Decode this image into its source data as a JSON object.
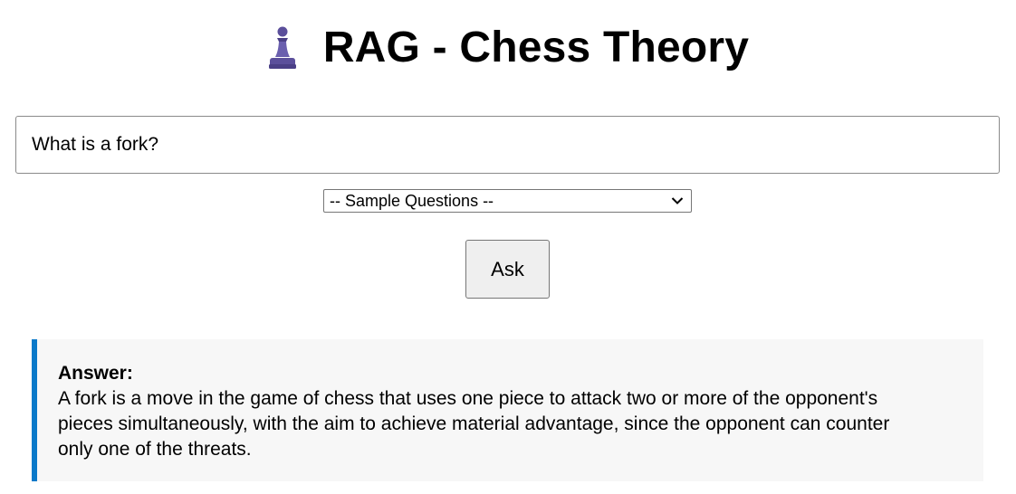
{
  "header": {
    "title": "RAG - Chess Theory",
    "icon": "chess-pawn-icon",
    "icon_color": "#5b4f9b"
  },
  "query": {
    "value": "What is a fork?"
  },
  "sample_questions": {
    "selected": "-- Sample Questions --"
  },
  "ask_button": {
    "label": "Ask"
  },
  "answer": {
    "heading": "Answer:",
    "text": "A fork is a move in the game of chess that uses one piece to attack two or more of the opponent's pieces simultaneously, with the aim to achieve material advantage, since the opponent can counter only one of the threats.",
    "accent_color": "#0a79c9",
    "background_color": "#f7f7f7"
  }
}
